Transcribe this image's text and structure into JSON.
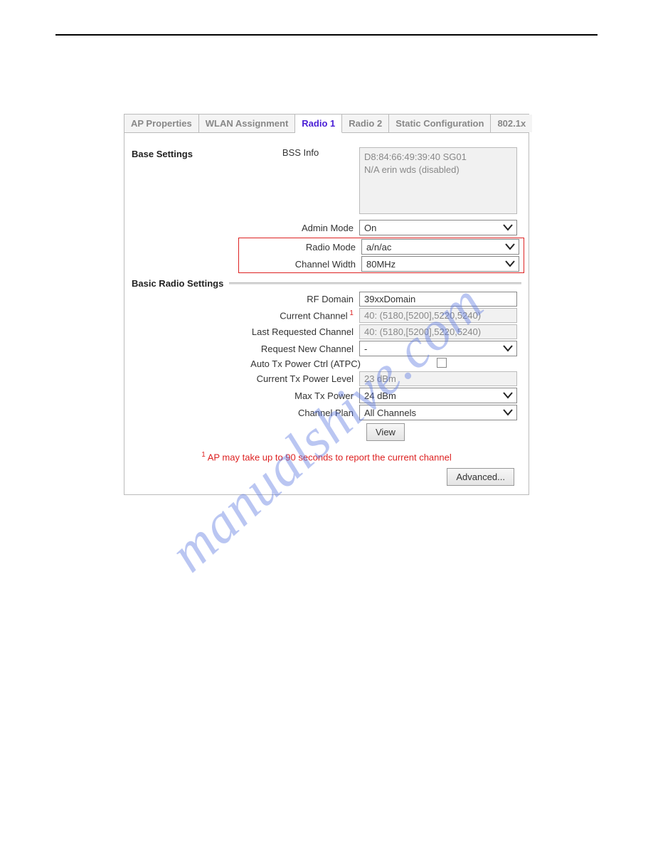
{
  "tabs": {
    "ap_properties": "AP Properties",
    "wlan_assignment": "WLAN Assignment",
    "radio1": "Radio 1",
    "radio2": "Radio 2",
    "static_config": "Static Configuration",
    "dot1x": "802.1x"
  },
  "sections": {
    "base": "Base Settings",
    "basic_radio": "Basic Radio Settings"
  },
  "labels": {
    "bss_info": "BSS Info",
    "admin_mode": "Admin Mode",
    "radio_mode": "Radio Mode",
    "channel_width": "Channel Width",
    "rf_domain": "RF Domain",
    "current_channel": "Current Channel",
    "last_requested_channel": "Last Requested Channel",
    "request_new_channel": "Request New Channel",
    "atpc": "Auto Tx Power Ctrl (ATPC)",
    "current_tx_power": "Current Tx Power Level",
    "max_tx_power": "Max Tx Power",
    "channel_plan": "Channel Plan"
  },
  "values": {
    "bss_info": "D8:84:66:49:39:40  SG01\nN/A  erin wds (disabled)",
    "admin_mode": "On",
    "radio_mode": "a/n/ac",
    "channel_width": "80MHz",
    "rf_domain": "39xxDomain",
    "current_channel": "40: (5180,[5200],5220,5240)",
    "last_requested_channel": "40: (5180,[5200],5220,5240)",
    "request_new_channel": "-",
    "current_tx_power": "23 dBm",
    "max_tx_power": "24 dBm",
    "channel_plan": "All Channels"
  },
  "buttons": {
    "view": "View",
    "advanced": "Advanced..."
  },
  "footnote_sup": "1",
  "footnote": " AP may take up to 90 seconds to report the current channel",
  "watermark": "manualshive.com"
}
